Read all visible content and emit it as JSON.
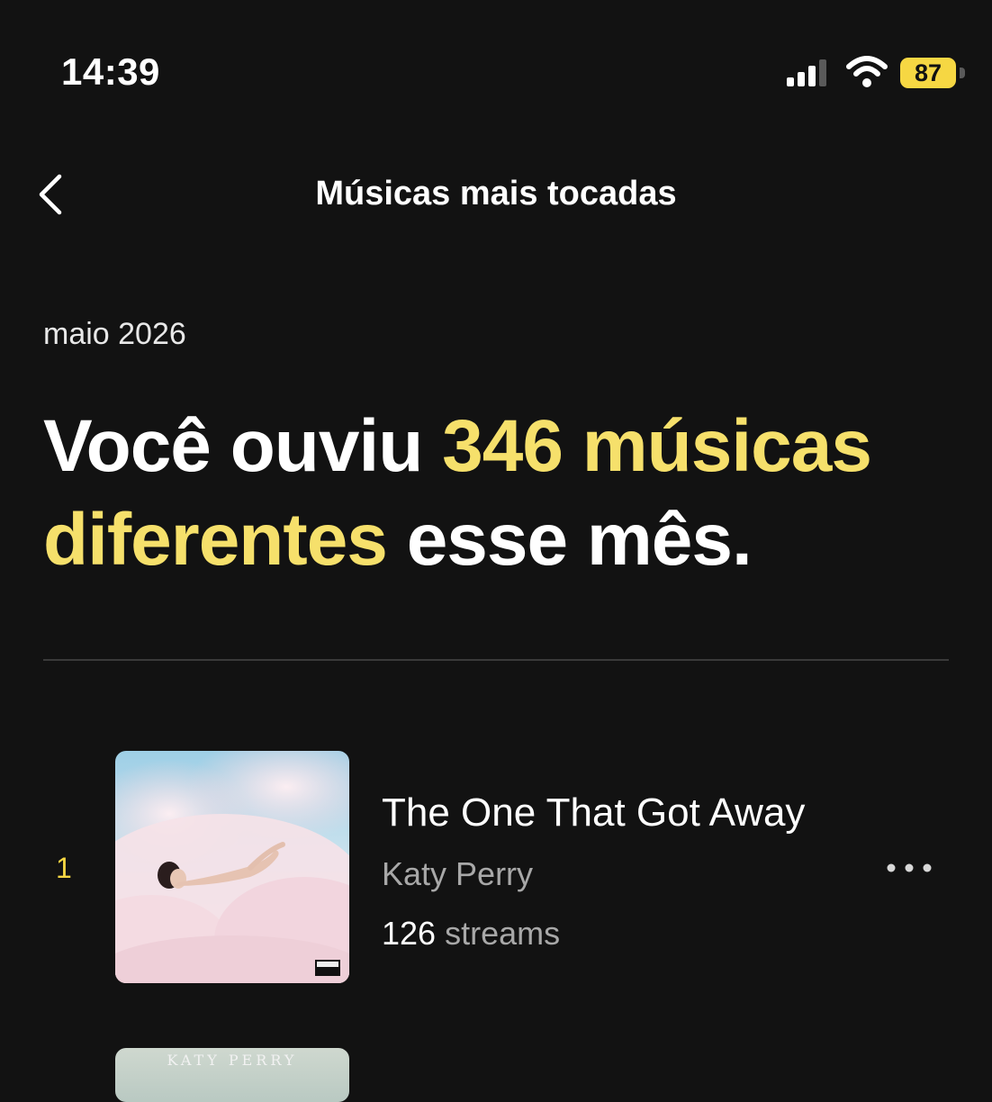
{
  "status_bar": {
    "time": "14:39",
    "battery_level": "87",
    "signal_icon": "cellular-signal-icon",
    "wifi_icon": "wifi-icon",
    "battery_color": "#f6d743"
  },
  "nav": {
    "back_icon": "chevron-left-icon",
    "title": "Músicas mais tocadas"
  },
  "summary": {
    "period": "maio 2026",
    "headline_prefix": "Você ouviu ",
    "headline_highlight": "346 músicas diferentes",
    "headline_suffix": " esse mês.",
    "highlight_color": "#f6e06b"
  },
  "tracks": [
    {
      "rank": "1",
      "title": "The One That Got Away",
      "artist": "Katy Perry",
      "streams_count": "126",
      "streams_unit": "streams",
      "cover_art": "album-cover-image",
      "more_icon": "more-horizontal-icon"
    },
    {
      "cover_text": "KATY PERRY",
      "cover_art": "album-cover-image"
    }
  ],
  "colors": {
    "background": "#121212",
    "accent": "#f6d743",
    "secondary_text": "#a8a8a8"
  }
}
